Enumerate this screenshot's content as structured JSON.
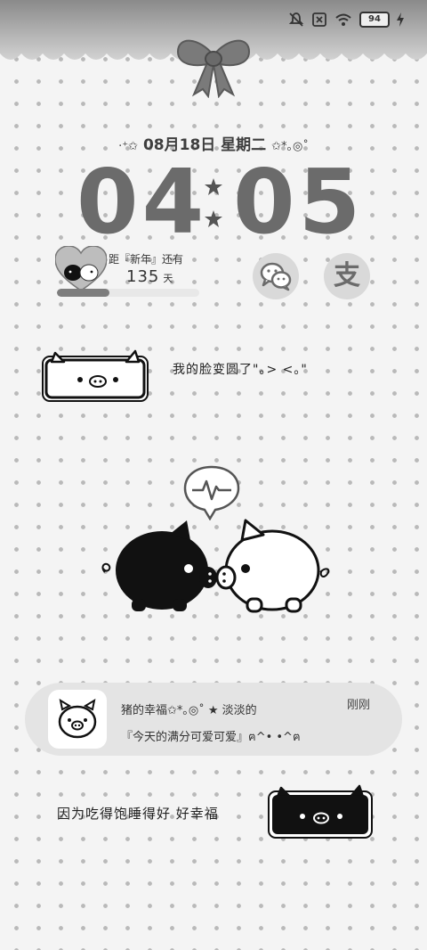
{
  "status_bar": {
    "battery_level": "94",
    "icons": [
      "mute-icon",
      "no-sim-icon",
      "wifi-icon",
      "battery-icon",
      "charging-icon"
    ]
  },
  "date": {
    "prefix_deco": "‧⁺✩",
    "text": "08月18日  星期二",
    "suffix_deco": "✩*｡◎˚"
  },
  "clock": {
    "hours": "04",
    "minutes": "05"
  },
  "countdown": {
    "label": "距『新年』还有",
    "days": "135",
    "unit": "天",
    "progress": 0.37
  },
  "shortcuts": [
    {
      "name": "wechat",
      "glyph": "wechat-icon"
    },
    {
      "name": "alipay",
      "glyph": "支"
    }
  ],
  "speech": "我的脸变圆了\"｡>  <｡\"",
  "notification": {
    "title": "猪的幸福✩*｡◎˚  ★ 淡淡的",
    "body": "『今天的满分可爱可爱』ฅ^•    •^ฅ",
    "time": "刚刚"
  },
  "slogan": "因为吃得饱睡得好  好幸福",
  "colors": {
    "background": "#f4f4f4",
    "dots": "#b9b9b9",
    "clock": "#6b6b6b",
    "panel": "#e4e4e4"
  }
}
